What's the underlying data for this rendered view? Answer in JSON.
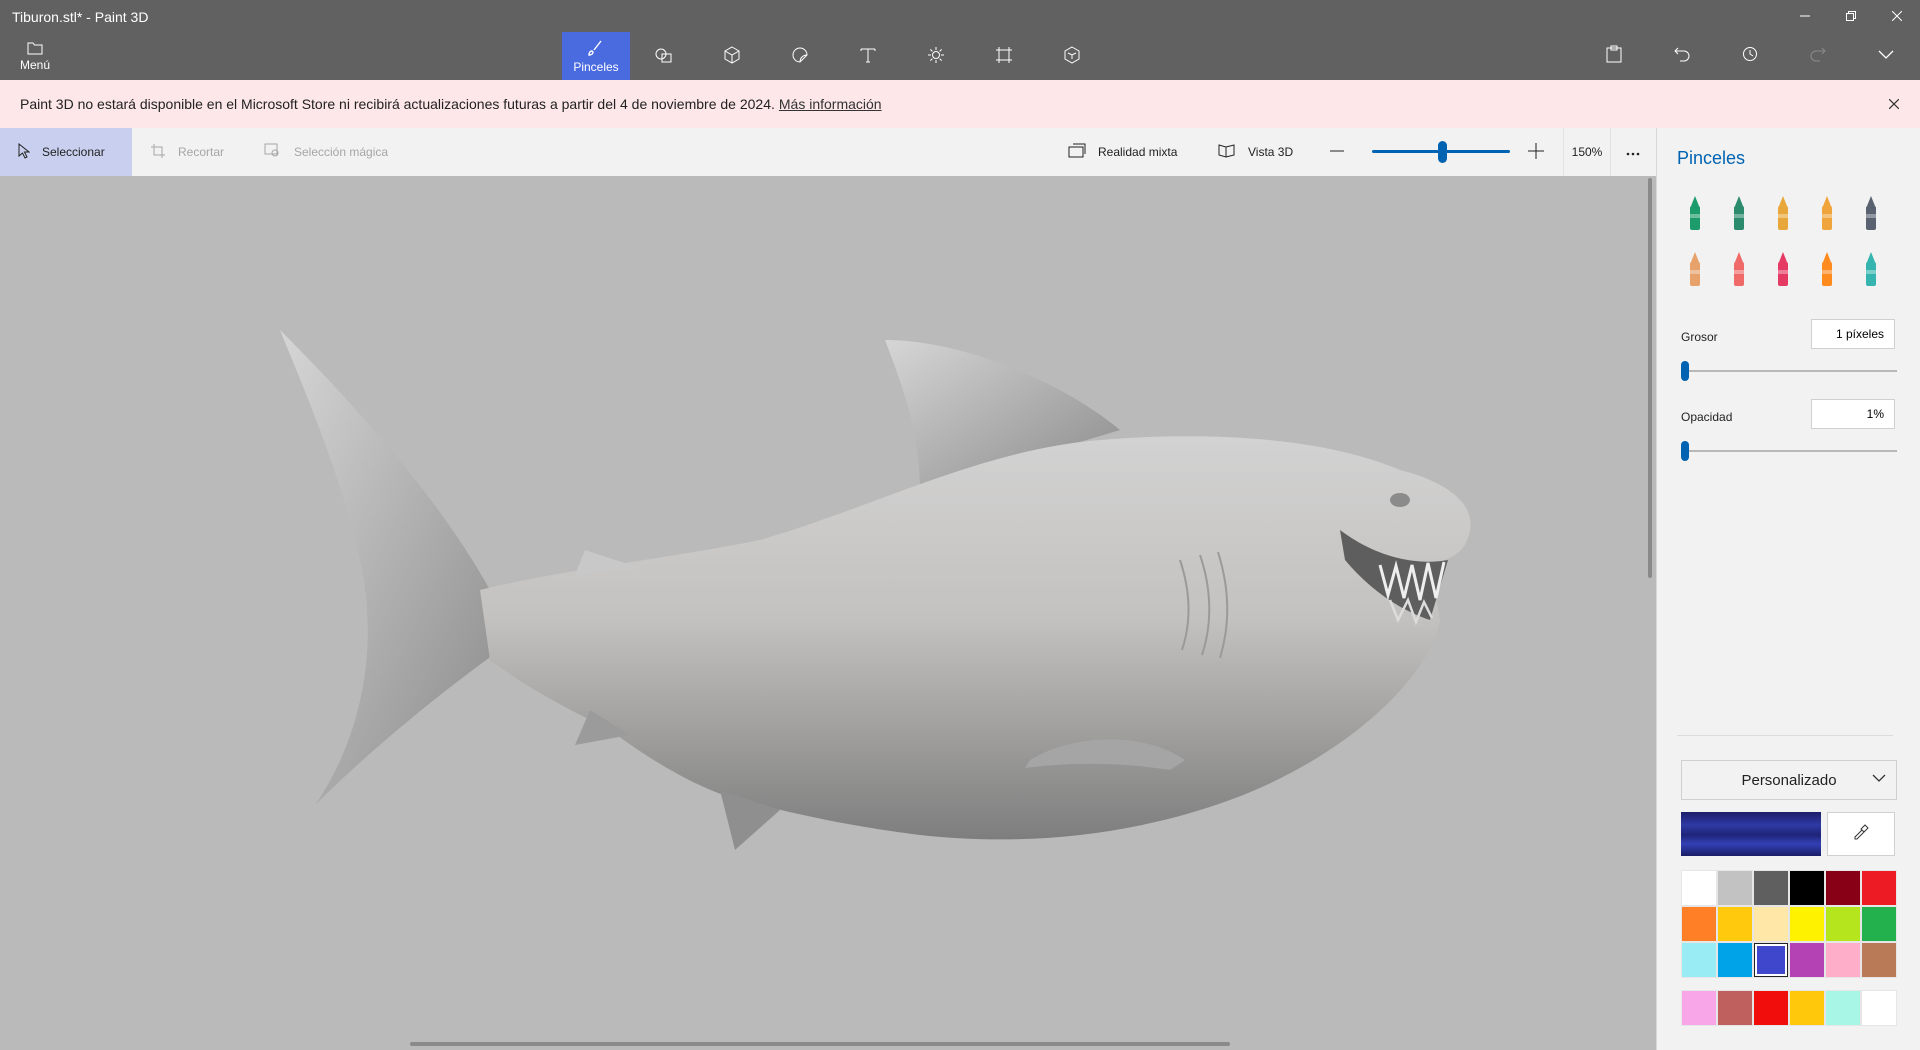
{
  "window": {
    "title": "Tiburon.stl* - Paint 3D"
  },
  "ribbon": {
    "menu_label": "Menú",
    "active_tool_label": "Pinceles",
    "tools": [
      "brush-icon",
      "2d-shapes-icon",
      "3d-shapes-icon",
      "stickers-icon",
      "text-icon",
      "effects-icon",
      "canvas-icon",
      "3d-library-icon"
    ]
  },
  "banner": {
    "message": "Paint 3D no estará disponible en el Microsoft Store ni recibirá actualizaciones futuras a partir del 4 de noviembre de 2024.",
    "link": "Más información"
  },
  "subbar": {
    "select": "Seleccionar",
    "crop": "Recortar",
    "magic_select": "Selección mágica",
    "mixed_reality": "Realidad mixta",
    "view_3d": "Vista 3D",
    "zoom": "150%"
  },
  "panel": {
    "title": "Pinceles",
    "brushes": [
      {
        "name": "marker",
        "color": "#1e9b6b"
      },
      {
        "name": "calligraphy-pen",
        "color": "#2c8a6d"
      },
      {
        "name": "oil-brush",
        "color": "#e8a73a"
      },
      {
        "name": "watercolor",
        "color": "#f0a43c"
      },
      {
        "name": "pixel-pen",
        "color": "#5a6170"
      },
      {
        "name": "pencil",
        "color": "#e7a26c"
      },
      {
        "name": "eraser",
        "color": "#f06a6a"
      },
      {
        "name": "crayon",
        "color": "#e53a63"
      },
      {
        "name": "spray-can",
        "color": "#ff8b1e"
      },
      {
        "name": "fill",
        "color": "#36b5b0"
      }
    ],
    "thickness_label": "Grosor",
    "thickness_value": "1 píxeles",
    "opacity_label": "Opacidad",
    "opacity_value": "1%",
    "color_mode": "Personalizado",
    "current_color": "#2a2f94",
    "palette": [
      "#ffffff",
      "#c2c2c2",
      "#5f5f5f",
      "#000000",
      "#880015",
      "#ed1c24",
      "#ff7f27",
      "#ffc90e",
      "#ffe7a8",
      "#fff200",
      "#b5e61d",
      "#22b14c",
      "#99ecf4",
      "#00a2e8",
      "#3f48cc",
      "#b442b5",
      "#ffaec9",
      "#b97a57"
    ],
    "palette_custom": [
      "#f8a6e8",
      "#c0605e",
      "#f20d0d",
      "#ffc80a",
      "#a7f6e6",
      "#ffffff"
    ],
    "selected_swatch": 14
  }
}
